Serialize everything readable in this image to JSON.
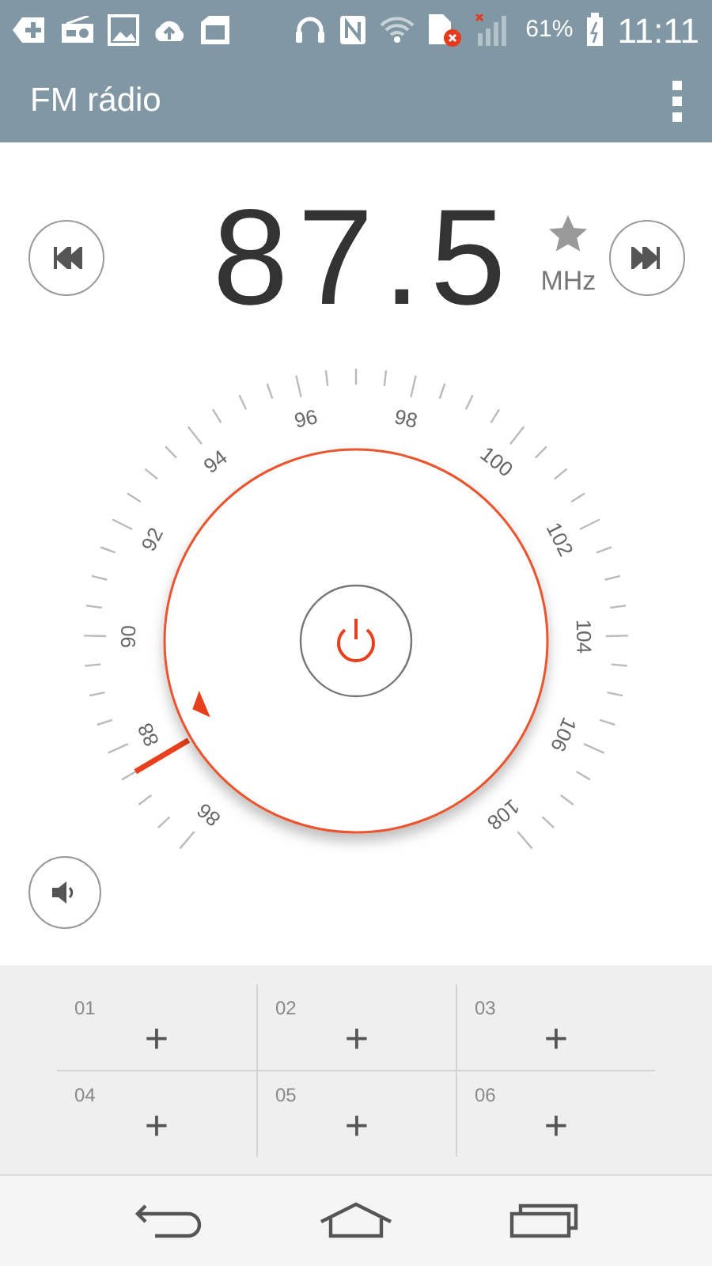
{
  "status_bar": {
    "battery": "61%",
    "time": "11:11"
  },
  "app_bar": {
    "title": "FM rádio"
  },
  "tuner": {
    "frequency": "87.5",
    "unit": "MHz",
    "favorite": false
  },
  "dial": {
    "labels": [
      "86",
      "88",
      "90",
      "92",
      "94",
      "96",
      "98",
      "100",
      "102",
      "104",
      "106",
      "108"
    ]
  },
  "presets": [
    {
      "number": "01",
      "icon": "+"
    },
    {
      "number": "02",
      "icon": "+"
    },
    {
      "number": "03",
      "icon": "+"
    },
    {
      "number": "04",
      "icon": "+"
    },
    {
      "number": "05",
      "icon": "+"
    },
    {
      "number": "06",
      "icon": "+"
    }
  ]
}
